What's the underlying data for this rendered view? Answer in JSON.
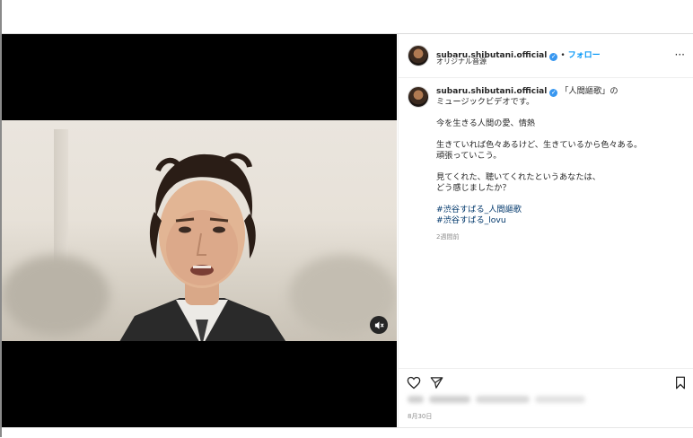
{
  "post": {
    "username": "subaru.shibutani.official",
    "verified_icon": "verified-badge-icon",
    "separator": "•",
    "follow_label": "フォロー",
    "audio_label": "オリジナル音源",
    "more_label": "···"
  },
  "caption": {
    "username": "subaru.shibutani.official",
    "lines": [
      "「人間謳歌」の",
      "ミュージックビデオです。",
      "今を生きる人間の愛、情熱",
      "生きていれば色々あるけど、生きているから色々ある。",
      "頑張っていこう。",
      "見てくれた、聴いてくれたというあなたは、",
      "どう感じましたか？"
    ],
    "hashtags": [
      "#渋谷すばる_人間謳歌",
      "#渋谷すばる_lovu"
    ],
    "time_ago": "2週間前"
  },
  "footer": {
    "date": "8月30日"
  },
  "icons": {
    "like": "heart-icon",
    "share": "send-icon",
    "save": "bookmark-icon",
    "mute": "speaker-muted-icon"
  },
  "colors": {
    "link": "#0095f6",
    "hashtag": "#00376b",
    "muted_text": "#8e8e8e",
    "verified": "#3897f0"
  }
}
